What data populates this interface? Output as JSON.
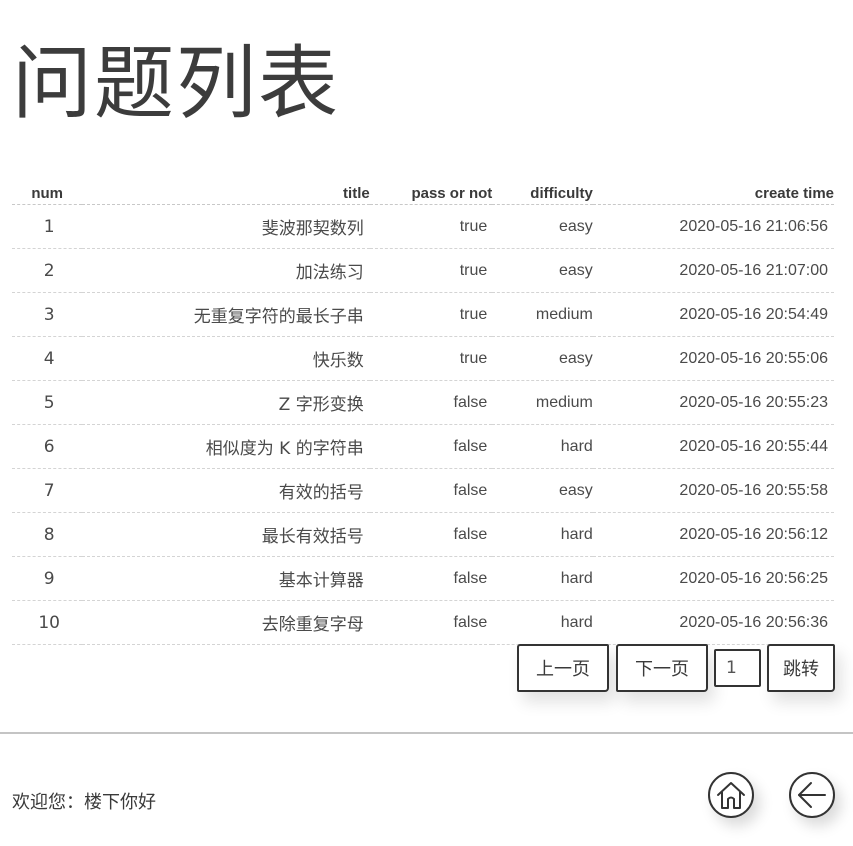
{
  "page": {
    "title": "问题列表"
  },
  "table": {
    "headers": {
      "num": "num",
      "title": "title",
      "pass": "pass or not",
      "difficulty": "difficulty",
      "create_time": "create time"
    },
    "rows": [
      {
        "num": "1",
        "title": "斐波那契数列",
        "pass": "true",
        "difficulty": "easy",
        "create_time": "2020-05-16 21:06:56"
      },
      {
        "num": "2",
        "title": "加法练习",
        "pass": "true",
        "difficulty": "easy",
        "create_time": "2020-05-16 21:07:00"
      },
      {
        "num": "3",
        "title": "无重复字符的最长子串",
        "pass": "true",
        "difficulty": "medium",
        "create_time": "2020-05-16 20:54:49"
      },
      {
        "num": "4",
        "title": "快乐数",
        "pass": "true",
        "difficulty": "easy",
        "create_time": "2020-05-16 20:55:06"
      },
      {
        "num": "5",
        "title": "Z 字形变换",
        "pass": "false",
        "difficulty": "medium",
        "create_time": "2020-05-16 20:55:23"
      },
      {
        "num": "6",
        "title": "相似度为 K 的字符串",
        "pass": "false",
        "difficulty": "hard",
        "create_time": "2020-05-16 20:55:44"
      },
      {
        "num": "7",
        "title": "有效的括号",
        "pass": "false",
        "difficulty": "easy",
        "create_time": "2020-05-16 20:55:58"
      },
      {
        "num": "8",
        "title": "最长有效括号",
        "pass": "false",
        "difficulty": "hard",
        "create_time": "2020-05-16 20:56:12"
      },
      {
        "num": "9",
        "title": "基本计算器",
        "pass": "false",
        "difficulty": "hard",
        "create_time": "2020-05-16 20:56:25"
      },
      {
        "num": "10",
        "title": "去除重复字母",
        "pass": "false",
        "difficulty": "hard",
        "create_time": "2020-05-16 20:56:36"
      }
    ]
  },
  "pager": {
    "prev_label": "上一页",
    "next_label": "下一页",
    "page_value": "1",
    "jump_label": "跳转"
  },
  "footer": {
    "welcome": "欢迎您：楼下你好",
    "home_icon": "home-icon",
    "back_icon": "arrow-left-icon"
  },
  "colors": {
    "text": "#3a3a3a",
    "border": "#333333",
    "divider": "#c4c4c4"
  }
}
